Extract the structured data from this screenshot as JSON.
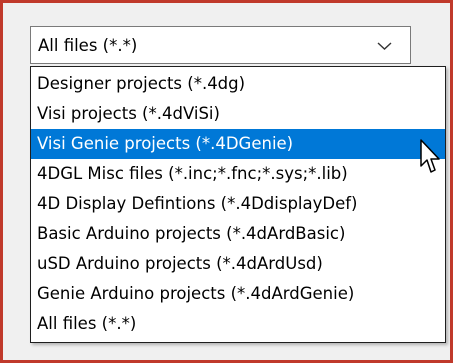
{
  "file_type_select": {
    "selected": "All files (*.*)",
    "options": [
      "Designer projects (*.4dg)",
      "Visi projects (*.4dViSi)",
      "Visi Genie projects (*.4DGenie)",
      "4DGL Misc files (*.inc;*.fnc;*.sys;*.lib)",
      "4D Display Defintions  (*.4DdisplayDef)",
      "Basic Arduino projects (*.4dArdBasic)",
      "uSD Arduino projects (*.4dArdUsd)",
      "Genie Arduino projects (*.4dArdGenie)",
      "All files (*.*)"
    ],
    "highlighted_option": "Visi Genie projects (*.4DGenie)",
    "chevron_icon": "chevron-down-icon",
    "cursor_icon": "mouse-pointer-icon"
  },
  "colors": {
    "highlight": "#0078d7",
    "annotation_border": "#c0392b"
  }
}
